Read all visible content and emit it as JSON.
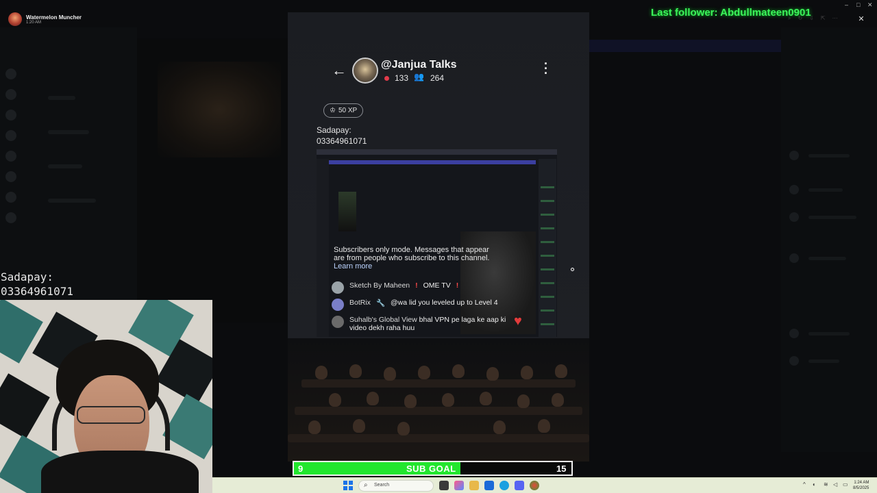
{
  "stream_profile": {
    "name": "Watermelon Muncher",
    "time": "1:20 AM"
  },
  "overlay": {
    "last_follower": "Last follower: Abdullmateen0901",
    "sadapay_label": "Sadapay:",
    "sadapay_number": "03364961071"
  },
  "channel": {
    "name": "@Janjua Talks",
    "viewers": "133",
    "followers": "264",
    "xp": "50 XP"
  },
  "phone_message": {
    "label": "Sadapay:",
    "number": "03364961071"
  },
  "embedded_chat": {
    "notice": "Subscribers only mode. Messages that appear are from people who subscribe to this channel.",
    "learn_more": "Learn more",
    "messages": [
      {
        "user": "Sketch By Maheen",
        "text": "OME TV",
        "avatar_color": "#9aa3a8"
      },
      {
        "user": "BotRix",
        "text": "@wa lid you leveled up to Level 4",
        "avatar_color": "#7a7fc8"
      },
      {
        "user": "Suhalb's Global View",
        "text": "bhal VPN pe laga ke aap ki video dekh raha huu",
        "avatar_color": "#6a6a6a"
      }
    ]
  },
  "sub_goal": {
    "label": "SUB GOAL",
    "current": "9",
    "target": "15",
    "progress": 0.6,
    "fill_color": "#22e62e"
  },
  "taskbar": {
    "search_placeholder": "Search",
    "time": "1:24 AM",
    "date": "8/5/2025"
  },
  "colors": {
    "follower_text": "#3cf25a",
    "taskbar_bg": "#e6ecd6"
  }
}
